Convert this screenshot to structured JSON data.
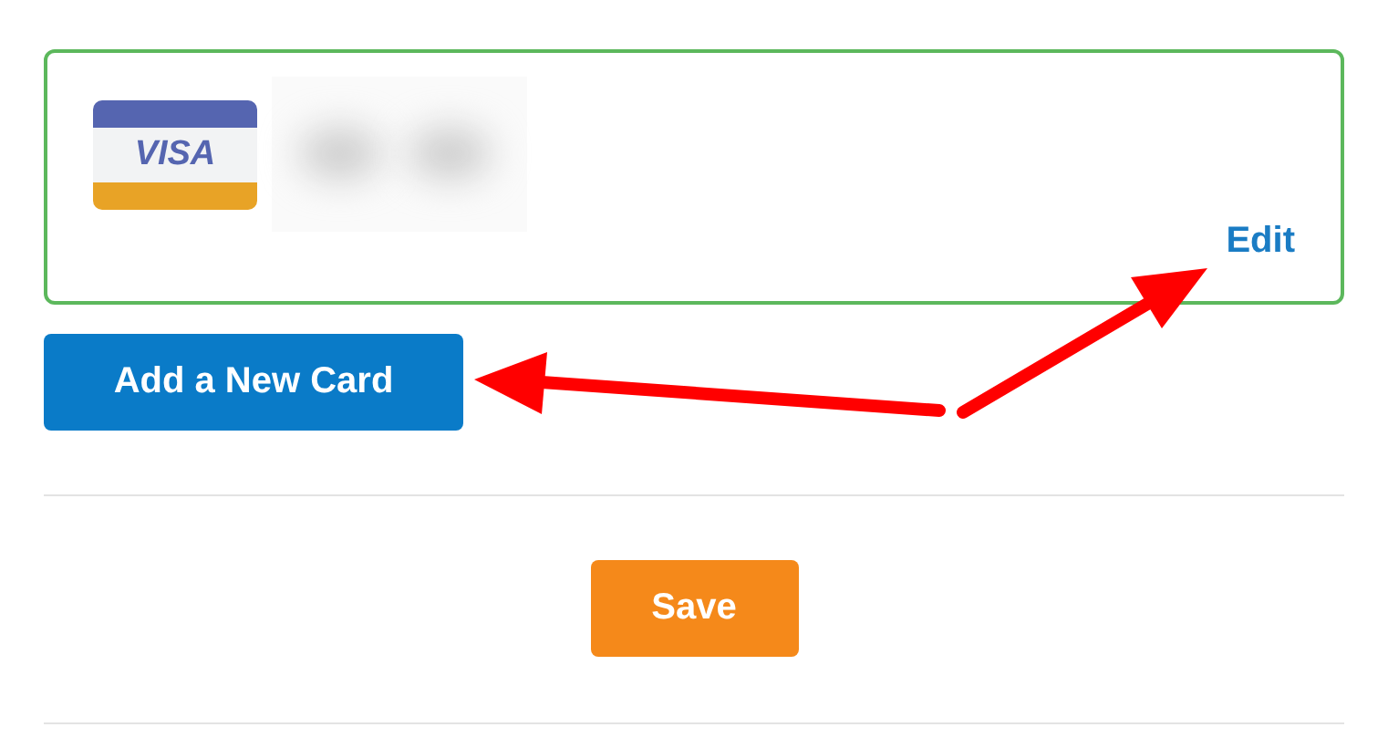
{
  "card": {
    "brand": "VISA",
    "edit_link": "Edit"
  },
  "add_card_button": "Add a New Card",
  "save_button": "Save"
}
